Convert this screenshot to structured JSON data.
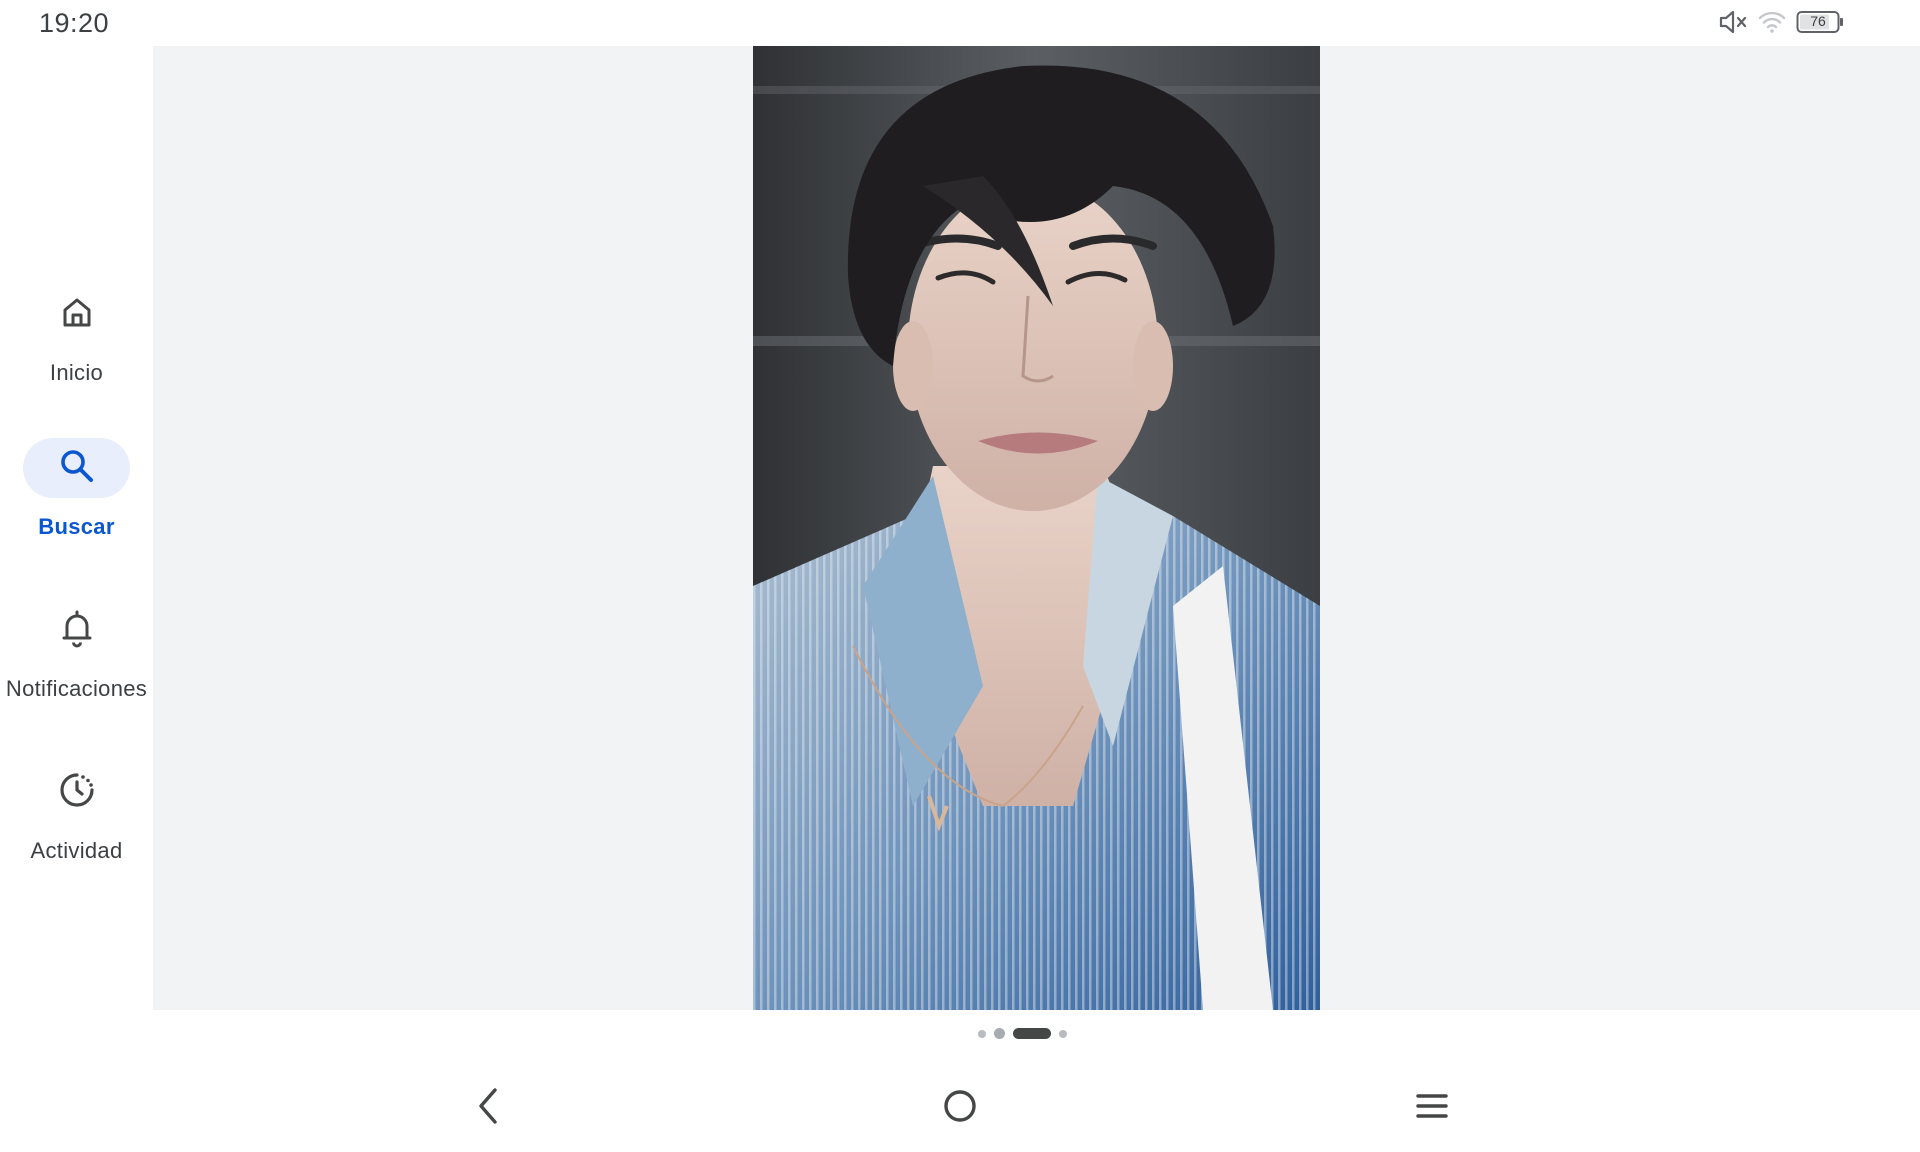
{
  "status_bar": {
    "time": "19:20",
    "icons": [
      "mute-icon",
      "wifi-icon",
      "battery-icon"
    ],
    "battery_level": "76"
  },
  "nav_rail": {
    "items": [
      {
        "label": "Inicio",
        "icon": "home-icon",
        "active": false
      },
      {
        "label": "Buscar",
        "icon": "search-icon",
        "active": true
      },
      {
        "label": "Notificaciones",
        "icon": "bell-icon",
        "active": false
      },
      {
        "label": "Actividad",
        "icon": "activity-icon",
        "active": false
      }
    ]
  },
  "viewer": {
    "image_description": "",
    "page_count": 4,
    "current_page": 3
  },
  "system_nav": {
    "buttons": [
      "back-icon",
      "home-circle-icon",
      "menu-icon"
    ]
  },
  "colors": {
    "accent": "#0b57d0",
    "active_pill": "#e8eefb",
    "content_bg": "#f2f3f5"
  }
}
